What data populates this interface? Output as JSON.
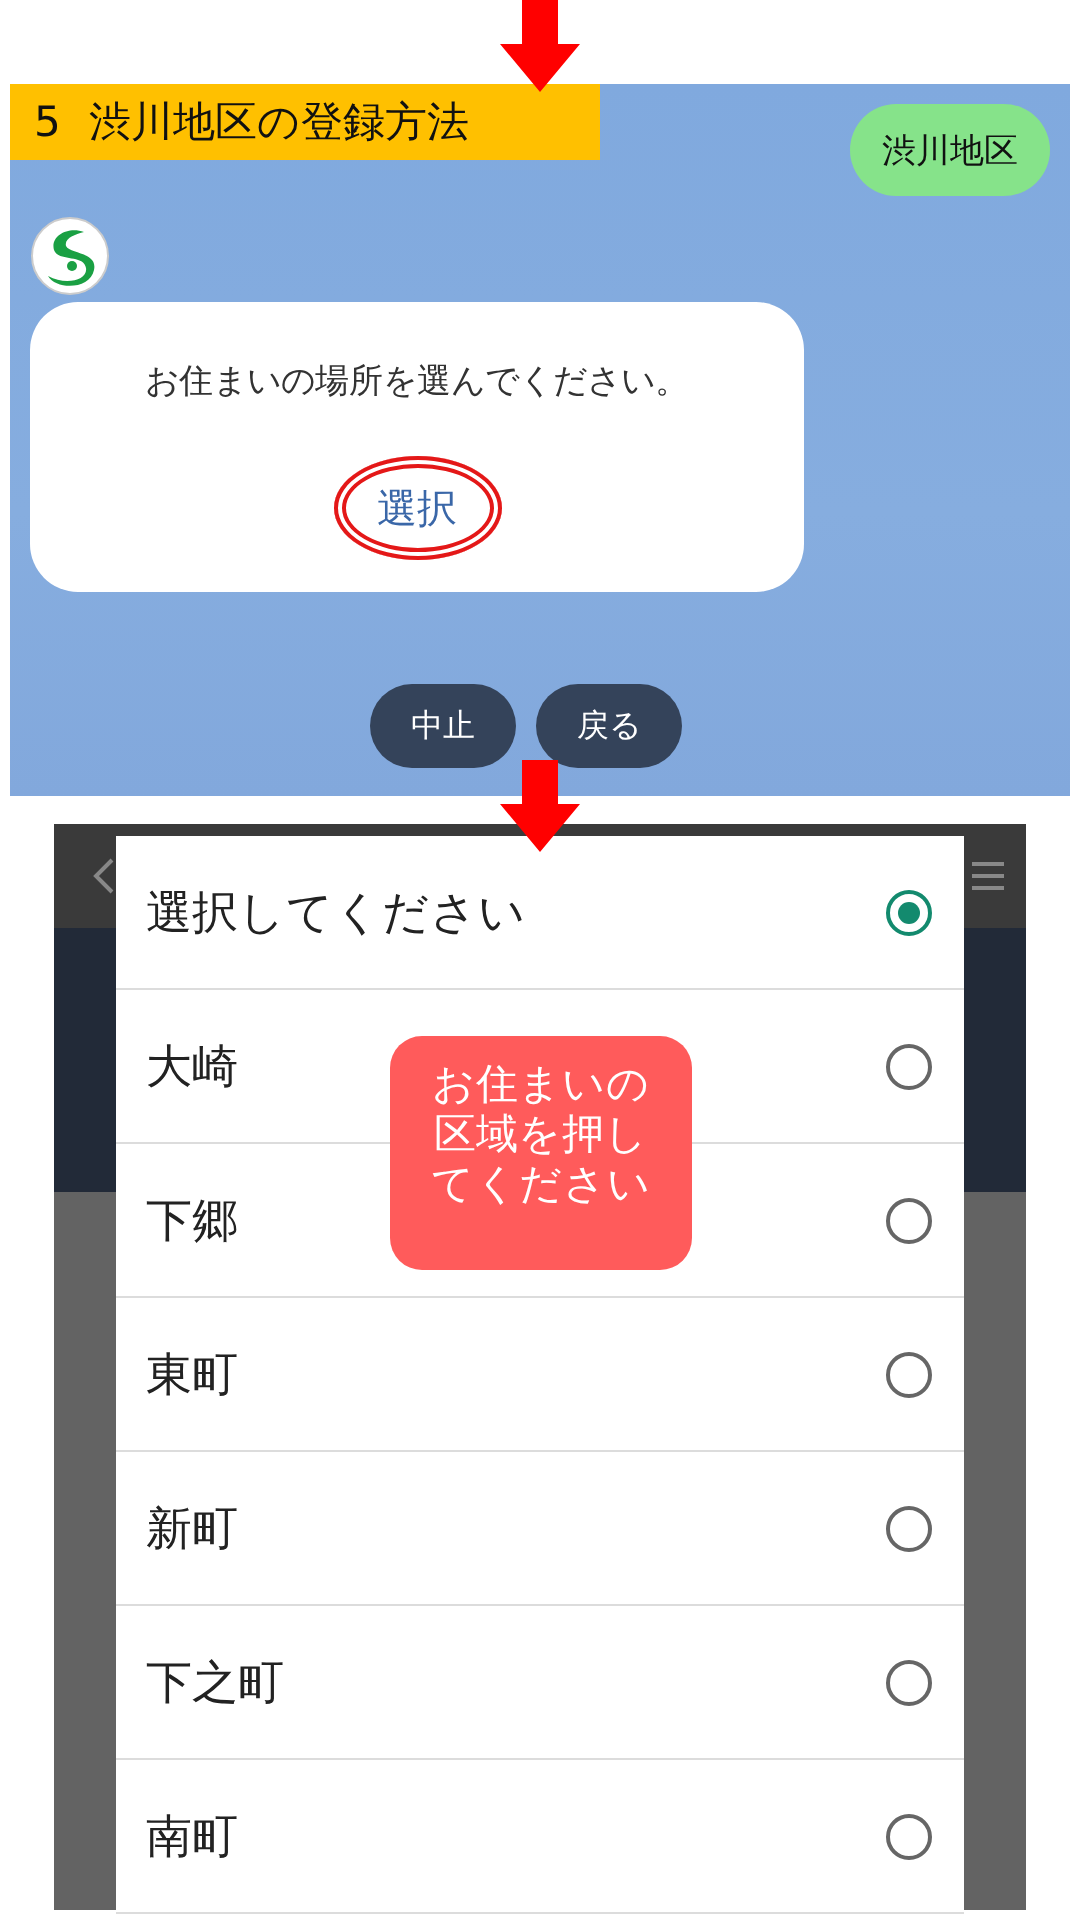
{
  "header": {
    "step": "5",
    "title": "渋川地区の登録方法"
  },
  "chat": {
    "user_message": "渋川地区",
    "bot_message": "お住まいの場所を選んでください。",
    "action": {
      "label": "選択",
      "highlighted": true
    },
    "quick_replies": [
      "中止",
      "戻る"
    ]
  },
  "picker": {
    "options": [
      {
        "label": "選択してください",
        "selected": true
      },
      {
        "label": "大崎",
        "selected": false
      },
      {
        "label": "下郷",
        "selected": false
      },
      {
        "label": "東町",
        "selected": false
      },
      {
        "label": "新町",
        "selected": false
      },
      {
        "label": "下之町",
        "selected": false
      },
      {
        "label": "南町",
        "selected": false
      }
    ]
  },
  "callout": "お住まいの区域を押してください"
}
